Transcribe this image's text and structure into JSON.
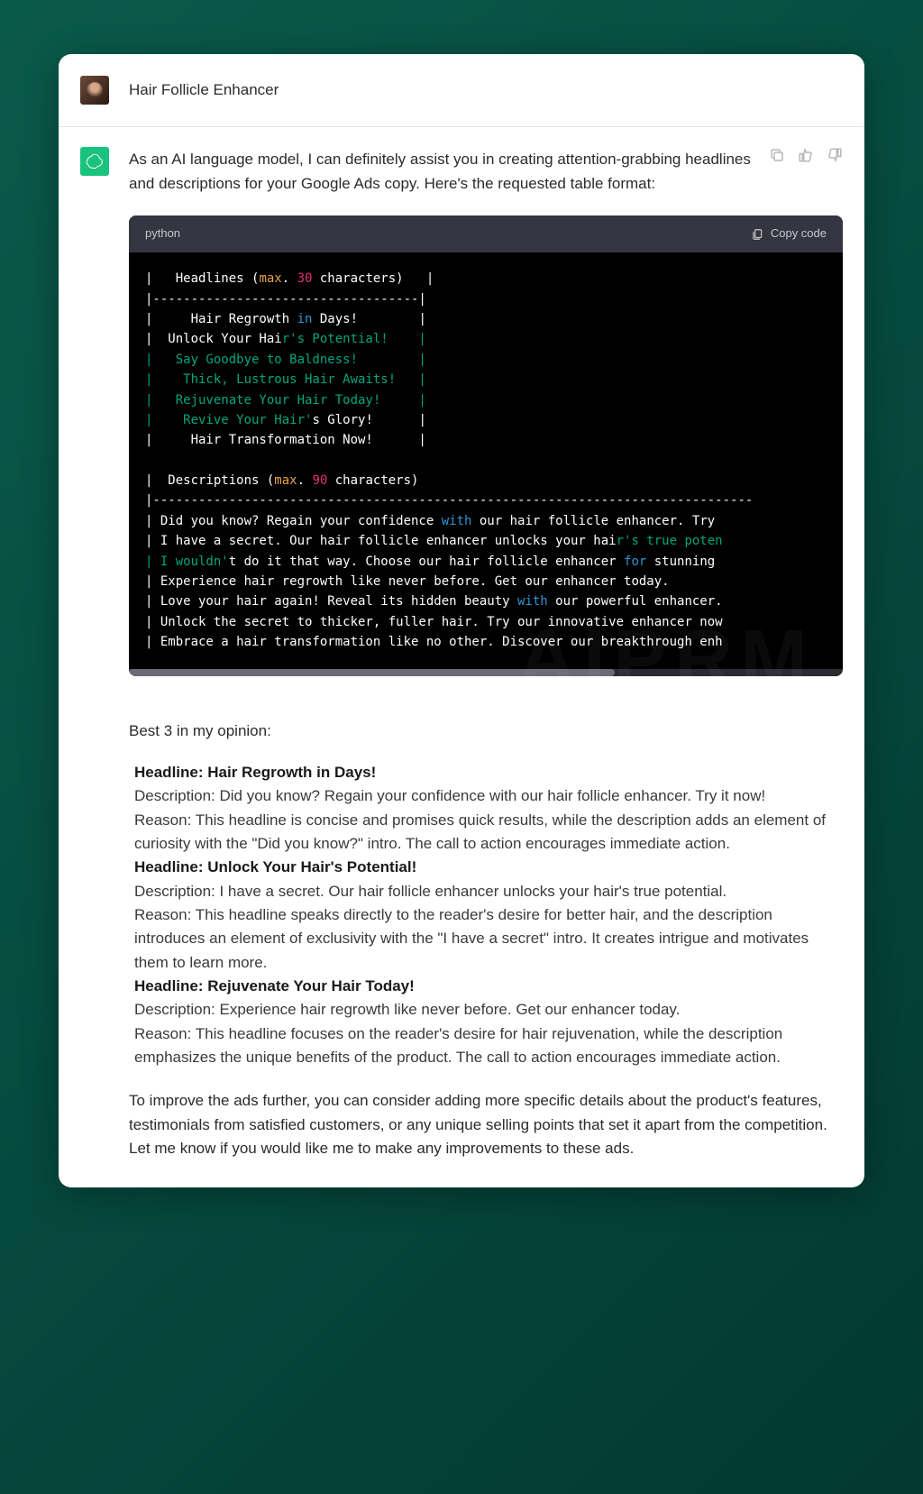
{
  "user": {
    "title": "Hair Follicle Enhancer"
  },
  "ai": {
    "intro": "As an AI language model, I can definitely assist you in creating attention-grabbing headlines and descriptions for your Google Ads copy. Here's the requested table format:"
  },
  "code": {
    "lang": "python",
    "copy_label": "Copy code",
    "lines": {
      "l1a": "|   Headlines (",
      "l1b": "max",
      "l1c": ". ",
      "l1d": "30",
      "l1e": " characters)   |",
      "l2": "|-----------------------------------|",
      "l3a": "|     Hair Regrowth ",
      "l3b": "in",
      "l3c": " Days!        |",
      "l4a": "|  Unlock Your Hai",
      "l4b": "r's Potential!    |",
      "l5a": "|   Say Goodbye to Baldness!        |",
      "l6a": "|    Thick, Lustrous Hair Awaits!   |",
      "l7a": "|   Rejuvenate Your Hair Today!     |",
      "l8a": "|    Revive Your Hair'",
      "l8b": "s Glory!      |",
      "l9a": "|     Hair Transformation Now!      |",
      "bl": "",
      "d1a": "|  Descriptions (",
      "d1b": "max",
      "d1c": ". ",
      "d1d": "90",
      "d1e": " characters)",
      "d2": "|-------------------------------------------------------------------------------",
      "d3a": "| Did you know? Regain your confidence ",
      "d3b": "with",
      "d3c": " our hair follicle enhancer. Try ",
      "d4a": "| I have a secret. Our hair follicle enhancer unlocks your hai",
      "d4b": "r's true poten",
      "d5a": "| I wouldn'",
      "d5b": "t do it that way. Choose our hair follicle enhancer ",
      "d5c": "for",
      "d5d": " stunning ",
      "d6a": "| Experience hair regrowth like never before. Get our enhancer today.",
      "d7a": "| Love your hair again! Reveal its hidden beauty ",
      "d7b": "with",
      "d7c": " our powerful enhancer.",
      "d8a": "| Unlock the secret to thicker, fuller hair. Try our innovative enhancer now",
      "d9a": "| Embrace a hair transformation like no other. Discover our breakthrough enh"
    }
  },
  "summary": {
    "intro": "Best 3 in my opinion:",
    "items": [
      {
        "headline": "Headline: Hair Regrowth in Days!",
        "description": "Description: Did you know? Regain your confidence with our hair follicle enhancer. Try it now!",
        "reason": "Reason: This headline is concise and promises quick results, while the description adds an element of curiosity with the \"Did you know?\" intro. The call to action encourages immediate action."
      },
      {
        "headline": "Headline: Unlock Your Hair's Potential!",
        "description": "Description: I have a secret. Our hair follicle enhancer unlocks your hair's true potential.",
        "reason": "Reason: This headline speaks directly to the reader's desire for better hair, and the description introduces an element of exclusivity with the \"I have a secret\" intro. It creates intrigue and motivates them to learn more."
      },
      {
        "headline": "Headline: Rejuvenate Your Hair Today!",
        "description": "Description: Experience hair regrowth like never before. Get our enhancer today.",
        "reason": "Reason: This headline focuses on the reader's desire for hair rejuvenation, while the description emphasizes the unique benefits of the product. The call to action encourages immediate action."
      }
    ],
    "closing": "To improve the ads further, you can consider adding more specific details about the product's features, testimonials from satisfied customers, or any unique selling points that set it apart from the competition. Let me know if you would like me to make any improvements to these ads."
  },
  "watermark": "AIPRM"
}
